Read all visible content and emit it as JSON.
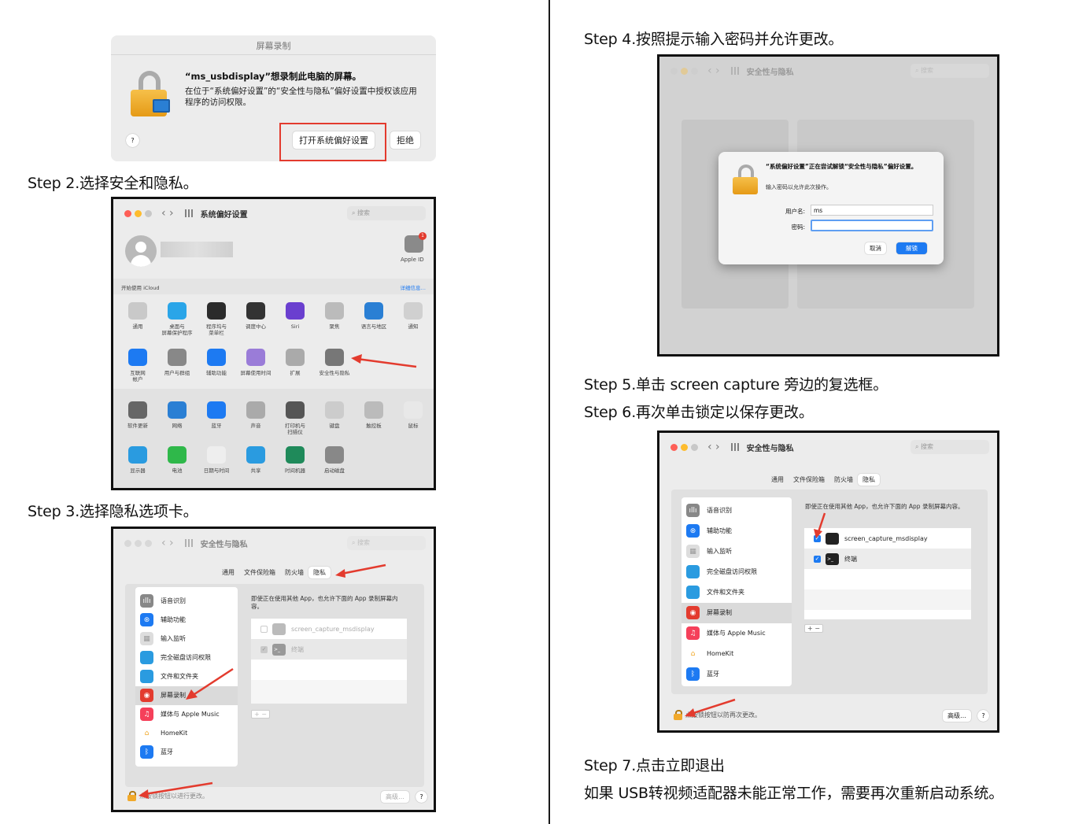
{
  "steps": {
    "step2": "Step 2.选择安全和隐私。",
    "step3": "Step 3.选择隐私选项卡。",
    "step4": "Step 4.按照提示输入密码并允许更改。",
    "step5": "Step 5.单击 screen capture 旁边的复选框。",
    "step6": "Step 6.再次单击锁定以保存更改。",
    "step7": "Step 7.点击立即退出",
    "note": "如果 USB转视频适配器未能正常工作，需要再次重新启动系统。"
  },
  "dialog1": {
    "title": "屏幕录制",
    "heading": "“ms_usbdisplay”想录制此电脑的屏幕。",
    "body": "在位于“系统偏好设置”的“安全性与隐私”偏好设置中授权该应用程序的访问权限。",
    "help": "?",
    "open_button": "打开系统偏好设置",
    "deny_button": "拒绝"
  },
  "sysprefs": {
    "title": "系统偏好设置",
    "search": "搜索",
    "apple_id": "Apple ID",
    "badge": "1",
    "icloud_text": "开始使用 iCloud",
    "details": "详细信息…",
    "row1": [
      "通用",
      "桌面与\n屏幕保护程序",
      "程序坞与\n菜单栏",
      "调度中心",
      "Siri",
      "聚焦",
      "语言与地区",
      "通知"
    ],
    "row2": [
      "互联网\n帐户",
      "用户与群组",
      "辅助功能",
      "屏幕使用时间",
      "扩展",
      "安全性与隐私"
    ],
    "row3": [
      "软件更新",
      "网络",
      "蓝牙",
      "声音",
      "打印机与\n扫描仪",
      "键盘",
      "触控板",
      "鼠标"
    ],
    "row4": [
      "显示器",
      "电池",
      "日期与时间",
      "共享",
      "时间机器",
      "启动磁盘"
    ]
  },
  "security": {
    "title": "安全性与隐私",
    "search": "搜索",
    "tabs": [
      "通用",
      "文件保险箱",
      "防火墙",
      "隐私"
    ],
    "sidebar": [
      "语音识别",
      "辅助功能",
      "输入监听",
      "完全磁盘访问权限",
      "文件和文件夹",
      "屏幕录制",
      "媒体与 Apple Music",
      "HomeKit",
      "蓝牙"
    ],
    "description": "即使正在使用其他 App，也允许下面的 App 录制屏幕内容。",
    "apps": [
      "screen_capture_msdisplay",
      "终端"
    ],
    "footer_step3": "点按锁按钮以进行更改。",
    "footer_step6": "点按锁按钮以防再次更改。",
    "advanced": "高级…",
    "help": "?",
    "plus": "+",
    "minus": "−"
  },
  "auth_dialog": {
    "heading": "“系统偏好设置”正在尝试解锁“安全性与隐私”偏好设置。",
    "sub": "输入密码以允许此次操作。",
    "username_label": "用户名:",
    "username_value": "ms",
    "password_label": "密码:",
    "cancel": "取消",
    "unlock": "解锁"
  },
  "colors": {
    "accent_red": "#e33b2e",
    "mac_blue": "#1d7af2",
    "lock_orange": "#f1a92b"
  }
}
